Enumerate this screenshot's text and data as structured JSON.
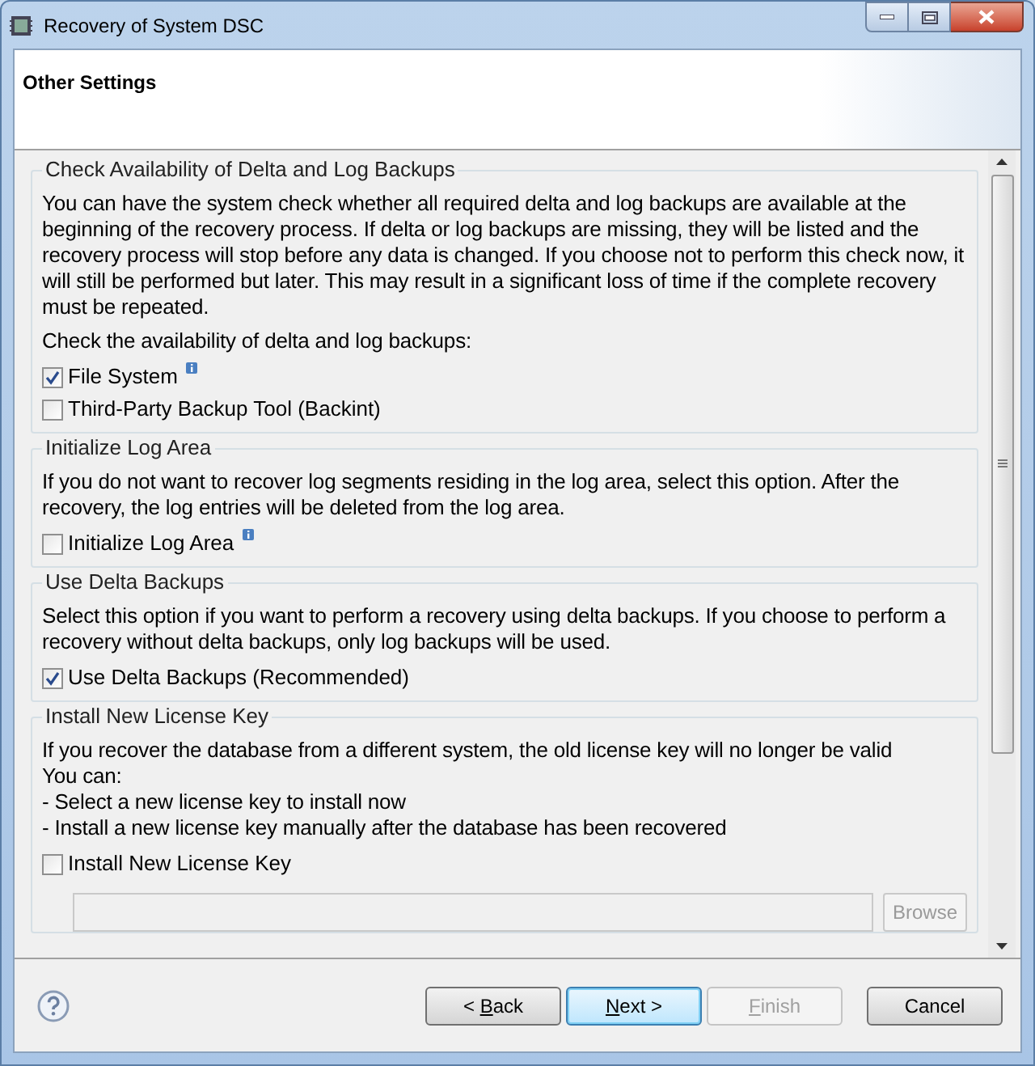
{
  "window": {
    "title": "Recovery of System DSC"
  },
  "header": {
    "title": "Other Settings"
  },
  "sections": [
    {
      "title": "Check Availability of Delta and Log Backups",
      "paragraphs": [
        "You can have the system check whether all required delta and log backups are available at the beginning of the recovery process. If delta or log backups are missing, they will be listed and the recovery process will stop before any data is changed. If you choose not to perform this check now, it will still be performed but later. This may result in a significant loss of time if the complete recovery must be repeated.",
        "Check the availability of delta and log backups:"
      ],
      "options": [
        {
          "label": "File System",
          "checked": true,
          "info": true
        },
        {
          "label": "Third-Party Backup Tool (Backint)",
          "checked": false,
          "info": false
        }
      ]
    },
    {
      "title": "Initialize Log Area",
      "paragraphs": [
        "If you do not want to recover log segments residing in the log area, select this option. After the recovery, the log entries will be deleted from the log area."
      ],
      "options": [
        {
          "label": "Initialize Log Area",
          "checked": false,
          "info": true
        }
      ]
    },
    {
      "title": "Use Delta Backups",
      "paragraphs": [
        "Select this option if you want to perform a recovery using delta backups. If you choose to perform a recovery without delta backups, only log backups will be used."
      ],
      "options": [
        {
          "label": "Use Delta Backups (Recommended)",
          "checked": true,
          "info": false
        }
      ]
    },
    {
      "title": "Install New License Key",
      "paragraphs": [
        "If you recover the database from a different system, the old license key will no longer be valid",
        "You can:",
        "- Select a new license key to install now",
        "- Install a new license key manually after the database has been recovered"
      ],
      "options": [
        {
          "label": "Install New License Key",
          "checked": false,
          "info": false
        }
      ],
      "file_field": {
        "button": "Browse",
        "disabled": true
      }
    }
  ],
  "buttons": [
    {
      "prefix": "< ",
      "key": "B",
      "rest": "ack",
      "default": false,
      "disabled": false
    },
    {
      "key": "N",
      "rest": "ext >",
      "default": true,
      "disabled": false
    },
    {
      "key": "F",
      "rest": "inish",
      "default": false,
      "disabled": true
    },
    {
      "rest": "Cancel",
      "default": false,
      "disabled": false
    }
  ]
}
